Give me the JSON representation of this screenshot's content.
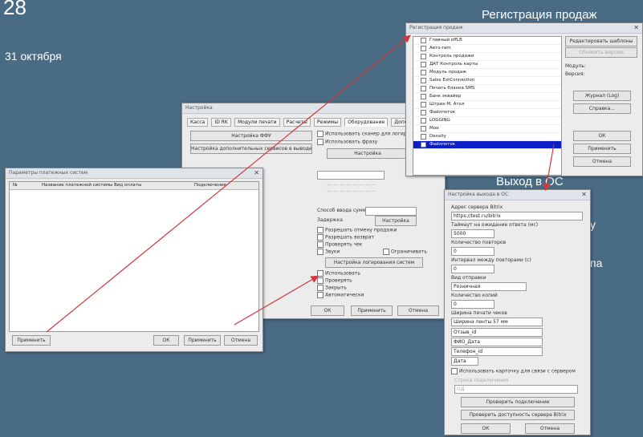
{
  "desktop": {
    "date_day": "28",
    "date_month": "31 октября",
    "title": "Регистрация продаж",
    "exit_label": "Выход в ОС",
    "edge_fragment_1": "у",
    "edge_fragment_2": "па"
  },
  "settings": {
    "title": "Настройка",
    "tabs": [
      "Касса",
      "ID RK",
      "Модули печати",
      "Расчеты",
      "Режимы",
      "Оборудование",
      "Дополнительно"
    ],
    "btn_network": "Настройка ФФУ",
    "btn_extra": "Настройка дополнительных сервисов в выводе",
    "btn_settings": "Настройка",
    "btn_log_settings": "Настройка логирования систем",
    "btn_settings2": "Настройка",
    "btn_ok": "ОК",
    "btn_apply": "Применить",
    "btn_cancel": "Отмена",
    "chk_1": "Использовать сканер для логирования",
    "chk_2": "Использовать фразу",
    "chk_3": "Разрешать отмену продажи",
    "chk_4": "Разрешать возврат",
    "chk_5": "Проверять чек",
    "chk_6": "Звуки",
    "chk_7": "Ограничивать",
    "chk_8": "Использовать",
    "chk_9": "Проверять",
    "chk_10": "Закрыть",
    "chk_11": "Автоматически",
    "lbl_input": "Способ ввода суммы",
    "lbl_delay": "Задержка"
  },
  "sales": {
    "title": "Регистрация продаж",
    "rows": [
      "Главный offLB",
      "Авто-ram",
      "Контроль продажи",
      "ДАТ Контроль карты",
      "Модуль продаж",
      "Sales ExtConnection",
      "Печать бланка SMS",
      "Банк эквайер",
      "Штрих-М, Атол",
      "Файлпоток",
      "LOGGING",
      "Мои",
      "Density",
      "Файлпоток"
    ],
    "btn_edit": "Редактировать шаблоны",
    "btn_update": "Обновить версию",
    "lbl_path": "Модуль:",
    "lbl_version": "Версия:",
    "btn_log": "Журнал (Log)",
    "btn_info": "Справка...",
    "btn_ok": "ОК",
    "btn_apply": "Применить",
    "btn_cancel": "Отмена"
  },
  "payment": {
    "title": "Параметры платежных систем",
    "col_1": "№",
    "col_2": "Название платежной системы",
    "col_3": "Вид оплаты",
    "col_4": "Подключение",
    "btn_apply": "Применить",
    "btn_ok": "ОК",
    "btn_apply2": "Применить",
    "btn_cancel": "Отмена"
  },
  "exit": {
    "title": "Настройка выхода в ОС",
    "lbl_url": "Адрес сервера Bitrix",
    "url_value": "https://test.ru/bitrix",
    "lbl_timeout": "Таймаут на ожидание ответа (мс)",
    "timeout_value": "5000",
    "lbl_count": "Количество повторов",
    "count_value": "0",
    "lbl_interval": "Интервал между повторами (с)",
    "interval_value": "0",
    "lbl_mode": "Вид отправки",
    "mode_value": "Розничная",
    "lbl_copies": "Количество копий",
    "copies_value": "0",
    "lbl_width": "Ширина печати чеков",
    "width_value": "Ширина ленты 57 мм",
    "field_a": "Отзыв_id",
    "field_b": "ФИО_Дата",
    "field_c": "Телефон_id",
    "field_d": "Дата",
    "chk_use": "Использовать карточку для связи с сервером",
    "lbl_connect": "Строка подключения",
    "connect_value": "ОД",
    "btn_check": "Проверить подключение",
    "btn_test": "Проверить доступность сервера Bitrix",
    "btn_ok": "ОК",
    "btn_cancel": "Отмена"
  },
  "colors": {
    "desktop_bg": "#4a6b84",
    "arrow": "#d0383d",
    "selection": "#0a1fc8"
  }
}
